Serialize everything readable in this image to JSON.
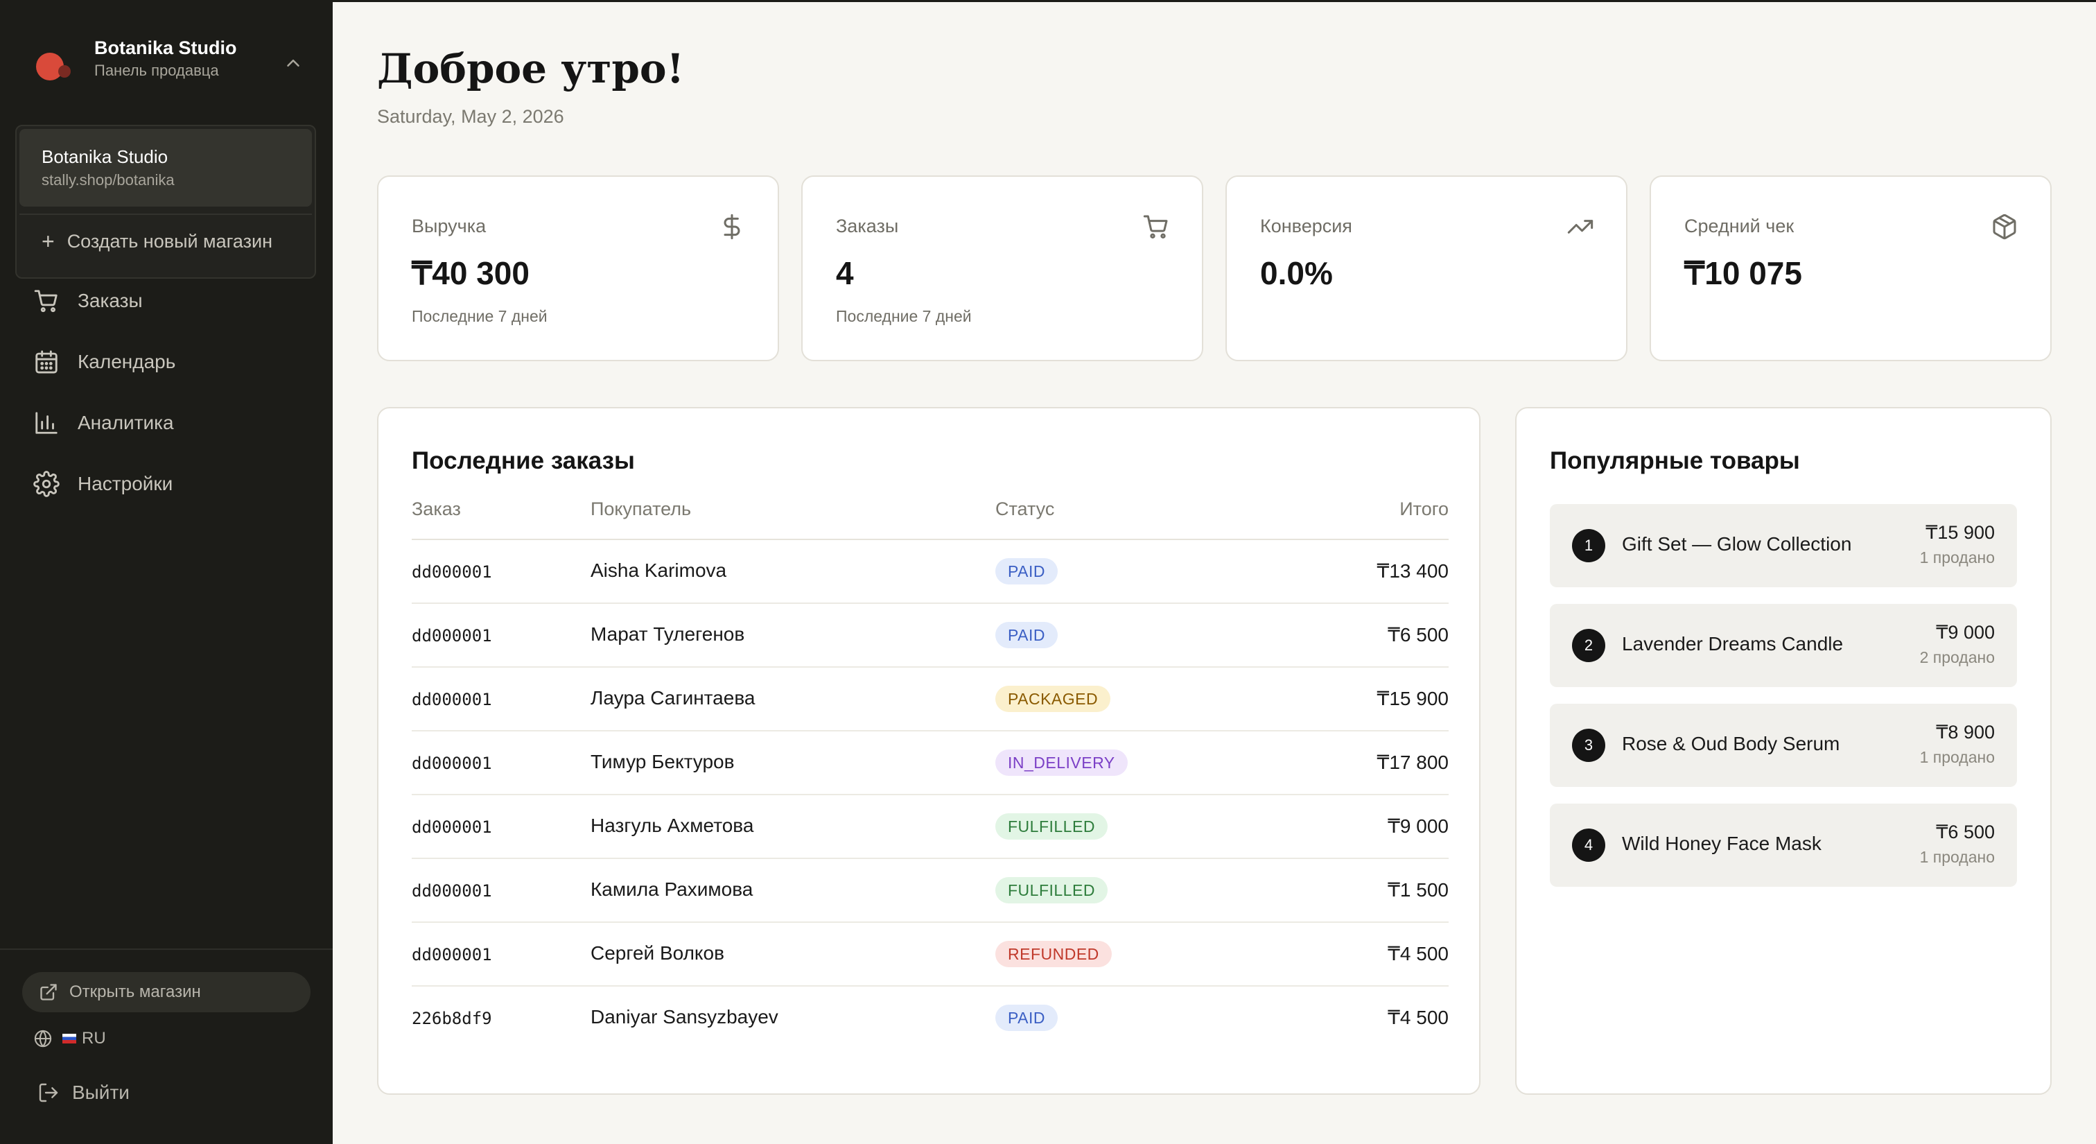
{
  "sidebar": {
    "brand_name": "Botanika Studio",
    "brand_subtitle": "Панель продавца",
    "store_switcher": {
      "current_name": "Botanika Studio",
      "current_url": "stally.shop/botanika",
      "create_label": "Создать новый магазин"
    },
    "nav": [
      {
        "label": "Заказы",
        "icon": "cart-icon"
      },
      {
        "label": "Календарь",
        "icon": "calendar-icon"
      },
      {
        "label": "Аналитика",
        "icon": "bar-chart-icon"
      },
      {
        "label": "Настройки",
        "icon": "gear-icon"
      }
    ],
    "open_store_label": "Открыть магазин",
    "language": "RU",
    "logout_label": "Выйти"
  },
  "main": {
    "greeting": "Доброе утро!",
    "date": "Saturday, May 2, 2026",
    "stats": [
      {
        "label": "Выручка",
        "value": "₸40 300",
        "sub": "Последние 7 дней",
        "icon": "dollar-icon"
      },
      {
        "label": "Заказы",
        "value": "4",
        "sub": "Последние 7 дней",
        "icon": "cart-icon"
      },
      {
        "label": "Конверсия",
        "value": "0.0%",
        "sub": "",
        "icon": "trending-up-icon"
      },
      {
        "label": "Средний чек",
        "value": "₸10 075",
        "sub": "",
        "icon": "box-icon"
      }
    ],
    "recent_orders": {
      "title": "Последние заказы",
      "columns": [
        "Заказ",
        "Покупатель",
        "Статус",
        "Итого"
      ],
      "rows": [
        {
          "id": "dd000001",
          "customer": "Aisha Karimova",
          "status": "PAID",
          "total": "₸13 400"
        },
        {
          "id": "dd000001",
          "customer": "Марат Тулегенов",
          "status": "PAID",
          "total": "₸6 500"
        },
        {
          "id": "dd000001",
          "customer": "Лаура Сагинтаева",
          "status": "PACKAGED",
          "total": "₸15 900"
        },
        {
          "id": "dd000001",
          "customer": "Тимур Бектуров",
          "status": "IN_DELIVERY",
          "total": "₸17 800"
        },
        {
          "id": "dd000001",
          "customer": "Назгуль Ахметова",
          "status": "FULFILLED",
          "total": "₸9 000"
        },
        {
          "id": "dd000001",
          "customer": "Камила Рахимова",
          "status": "FULFILLED",
          "total": "₸1 500"
        },
        {
          "id": "dd000001",
          "customer": "Сергей Волков",
          "status": "REFUNDED",
          "total": "₸4 500"
        },
        {
          "id": "226b8df9",
          "customer": "Daniyar Sansyzbayev",
          "status": "PAID",
          "total": "₸4 500"
        }
      ]
    },
    "popular_products": {
      "title": "Популярные товары",
      "items": [
        {
          "rank": "1",
          "name": "Gift Set — Glow Collection",
          "price": "₸15 900",
          "sold": "1 продано"
        },
        {
          "rank": "2",
          "name": "Lavender Dreams Candle",
          "price": "₸9 000",
          "sold": "2 продано"
        },
        {
          "rank": "3",
          "name": "Rose & Oud Body Serum",
          "price": "₸8 900",
          "sold": "1 продано"
        },
        {
          "rank": "4",
          "name": "Wild Honey Face Mask",
          "price": "₸6 500",
          "sold": "1 продано"
        }
      ]
    }
  },
  "colors": {
    "sidebar_bg": "#1c1c18",
    "main_bg": "#f7f6f2",
    "brand_dot": "#d94a3a",
    "status_paid": "#3b5fc4",
    "status_packaged": "#8a5a00",
    "status_in_delivery": "#7b3fc6",
    "status_fulfilled": "#2e7d3c",
    "status_refunded": "#c0392b"
  }
}
